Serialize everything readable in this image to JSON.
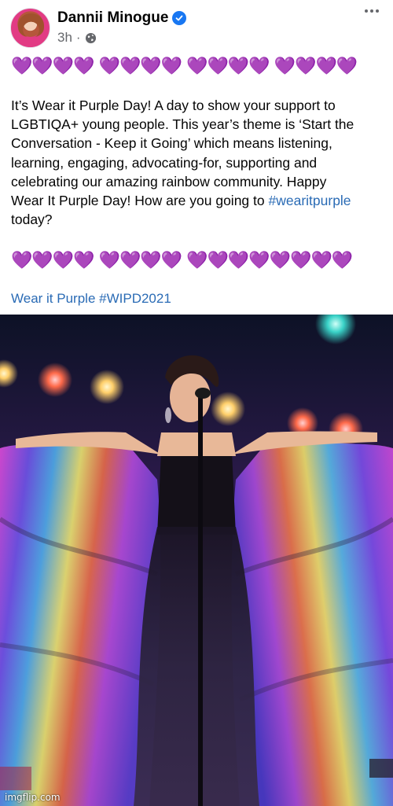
{
  "post": {
    "author_name": "Dannii Minogue",
    "timestamp": "3h",
    "separator": "·",
    "hearts_top": "💜💜💜💜 💜💜💜💜 💜💜💜💜 💜💜💜💜",
    "body_lines": [
      "It’s Wear it Purple Day! A day to show your support to",
      "LGBTIQA+ young people. This year’s theme is ‘Start the",
      "Conversation - Keep it Going’ which means listening,",
      "learning, engaging, advocating-for, supporting and",
      "celebrating our amazing rainbow community. Happy",
      "Wear It Purple Day! How are you going to "
    ],
    "hashtag_inline": "#wearitpurple",
    "body_last": "today?",
    "hearts_bottom": "💜💜💜💜 💜💜💜💜 💜💜💜💜💜💜💜💜",
    "bottom_link_text": "Wear it Purple",
    "bottom_hashtag": "#WIPD2021"
  },
  "photo": {
    "watermark": "imgflip.com"
  },
  "icons": {
    "verified": "verified-badge-icon",
    "privacy": "globe-icon",
    "more": "more-options-icon"
  },
  "colors": {
    "link": "#2a6bb5",
    "verified": "#1877f2",
    "heart": "#a23ce3",
    "meta": "#65676b"
  }
}
